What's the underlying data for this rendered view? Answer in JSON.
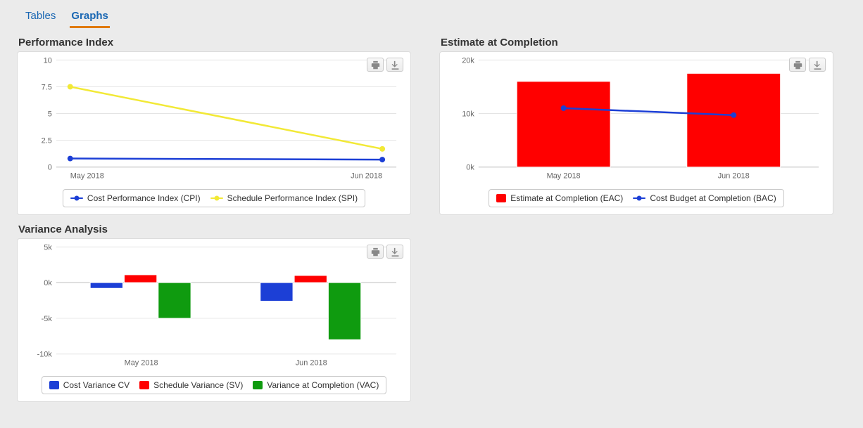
{
  "tabs": {
    "tables": "Tables",
    "graphs": "Graphs",
    "active": "graphs"
  },
  "panels": {
    "performance": {
      "title": "Performance Index"
    },
    "eac": {
      "title": "Estimate at Completion"
    },
    "variance": {
      "title": "Variance Analysis"
    }
  },
  "legend": {
    "cpi": "Cost Performance Index (CPI)",
    "spi": "Schedule Performance Index (SPI)",
    "eac": "Estimate at Completion (EAC)",
    "bac": "Cost Budget at Completion (BAC)",
    "cv": "Cost Variance CV",
    "sv": "Schedule Variance (SV)",
    "vac": "Variance at Completion (VAC)"
  },
  "colors": {
    "cpi": "#1c3fd6",
    "spi": "#f2e936",
    "eac_bar": "#ff0000",
    "bac_line": "#1c3fd6",
    "cv": "#1c3fd6",
    "sv": "#ff0000",
    "vac": "#0f9b0f"
  },
  "chart_data": [
    {
      "id": "performance",
      "type": "line",
      "title": "Performance Index",
      "categories": [
        "May 2018",
        "Jun 2018"
      ],
      "series": [
        {
          "name": "Cost Performance Index (CPI)",
          "color_key": "cpi",
          "values": [
            0.8,
            0.7
          ]
        },
        {
          "name": "Schedule Performance Index (SPI)",
          "color_key": "spi",
          "values": [
            7.5,
            1.7
          ]
        }
      ],
      "ylim": [
        0,
        10
      ],
      "yticks": [
        0,
        2.5,
        5,
        7.5,
        10
      ]
    },
    {
      "id": "eac",
      "type": "bar+line",
      "title": "Estimate at Completion",
      "categories": [
        "May 2018",
        "Jun 2018"
      ],
      "series": [
        {
          "name": "Estimate at Completion (EAC)",
          "kind": "bar",
          "color_key": "eac_bar",
          "values": [
            16000,
            17500
          ]
        },
        {
          "name": "Cost Budget at Completion (BAC)",
          "kind": "line",
          "color_key": "bac_line",
          "values": [
            11000,
            9700
          ]
        }
      ],
      "ylim": [
        0,
        20000
      ],
      "yticks": [
        0,
        10000,
        20000
      ],
      "ytick_labels": [
        "0k",
        "10k",
        "20k"
      ]
    },
    {
      "id": "variance",
      "type": "bar",
      "title": "Variance Analysis",
      "categories": [
        "May 2018",
        "Jun 2018"
      ],
      "series": [
        {
          "name": "Cost Variance CV",
          "color_key": "cv",
          "values": [
            -800,
            -2600
          ]
        },
        {
          "name": "Schedule Variance (SV)",
          "color_key": "sv",
          "values": [
            1100,
            1000
          ]
        },
        {
          "name": "Variance at Completion (VAC)",
          "color_key": "vac",
          "values": [
            -5000,
            -8000
          ]
        }
      ],
      "ylim": [
        -10000,
        5000
      ],
      "yticks": [
        -10000,
        -5000,
        0,
        5000
      ],
      "ytick_labels": [
        "-10k",
        "-5k",
        "0k",
        "5k"
      ]
    }
  ]
}
